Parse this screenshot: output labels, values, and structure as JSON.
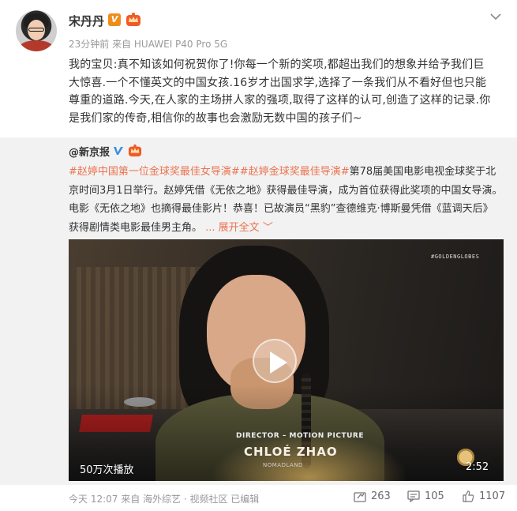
{
  "author": {
    "name": "宋丹丹",
    "verified_badge": "V",
    "meta": "23分钟前 来自 HUAWEI P40 Pro 5G"
  },
  "post": {
    "text": "我的宝贝:真不知该如何祝贺你了!你每一个新的奖项,都超出我们的想象并给予我们巨大惊喜.一个不懂英文的中国女孩.16岁才出国求学,选择了一条我们从不看好但也只能尊重的道路.今天,在人家的主场拼人家的强项,取得了这样的认可,创造了这样的记录.你是我们家的传奇,相信你的故事也会激励无数中国的孩子们~"
  },
  "repost": {
    "author": "@新京报",
    "hashtag1": "#赵婷中国第一位金球奖最佳女导演#",
    "hashtag2": "#赵婷金球奖最佳导演#",
    "body": "第78届美国电影电视金球奖于北京时间3月1日举行。赵婷凭借《无依之地》获得最佳导演，成为首位获得此奖项的中国女导演。电影《无依之地》也摘得最佳影片！恭喜！已故演员“黑豹”查德维克·博斯曼凭借《蓝调天后》获得剧情类电影最佳男主角。",
    "expand_label": "... 展开全文 ﹀"
  },
  "video": {
    "watermark": "#GOLDENGLOBES",
    "award_category": "DIRECTOR – MOTION PICTURE",
    "winner_name": "CHLOÉ ZHAO",
    "film_title": "NOMADLAND",
    "play_count": "50万次播放",
    "duration": "2:52"
  },
  "footer": {
    "meta": "今天 12:07 来自 海外综艺 · 视频社区   已编辑",
    "reposts": "263",
    "comments": "105",
    "likes": "1107"
  },
  "colors": {
    "accent": "#eb7350",
    "verified_orange": "#f08c1a",
    "verified_blue": "#3a8fdc",
    "repost_bg": "#f2f2f2"
  }
}
